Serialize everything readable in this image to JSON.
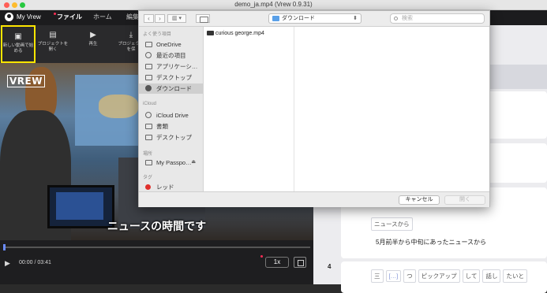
{
  "window": {
    "title": "demo_ja.mp4 (Vrew 0.9.31)"
  },
  "appbar": {
    "account_label": "My Vrew",
    "tabs": [
      {
        "label": "ファイル",
        "active": true
      },
      {
        "label": "ホーム",
        "active": false
      },
      {
        "label": "編集",
        "active": false
      }
    ]
  },
  "toolbar": {
    "items": [
      {
        "label": "新しい動画で始める",
        "icon": "video-file-icon",
        "highlighted": true
      },
      {
        "label": "プロジェクトを開く",
        "icon": "project-file-icon",
        "highlighted": false
      },
      {
        "label": "再生",
        "icon": "play-icon",
        "highlighted": false
      },
      {
        "label": "プロジェクトを保",
        "icon": "download-icon",
        "highlighted": false
      }
    ]
  },
  "video": {
    "logo": "VREW",
    "subtitle": "ニュースの時間です"
  },
  "player": {
    "time": "00:00 / 03:41",
    "speed": "1x",
    "progress": 0.0
  },
  "dialog": {
    "location": "ダウンロード",
    "search_placeholder": "検索",
    "sidebar": {
      "favorites_header": "よく使う項目",
      "favorites": [
        {
          "label": "OneDrive",
          "icon": "folder-icon"
        },
        {
          "label": "最近の項目",
          "icon": "clock-icon"
        },
        {
          "label": "アプリケーシ…",
          "icon": "applications-icon"
        },
        {
          "label": "デスクトップ",
          "icon": "desktop-icon"
        },
        {
          "label": "ダウンロード",
          "icon": "downloads-icon",
          "selected": true
        }
      ],
      "icloud_header": "iCloud",
      "icloud": [
        {
          "label": "iCloud Drive",
          "icon": "cloud-icon"
        },
        {
          "label": "書類",
          "icon": "document-icon"
        },
        {
          "label": "デスクトップ",
          "icon": "desktop-icon"
        }
      ],
      "locations_header": "場所",
      "locations": [
        {
          "label": "My Passpo…",
          "icon": "drive-icon",
          "eject": "⏏"
        }
      ],
      "tags_header": "タグ",
      "tags": [
        {
          "label": "レッド",
          "color": "#e0302c"
        }
      ]
    },
    "files": [
      {
        "name": "curious george.mp4",
        "icon": "video-file-icon"
      }
    ],
    "buttons": {
      "cancel": "キャンセル",
      "open": "開く"
    }
  },
  "editor": {
    "block3_words": [
      "ニュースから"
    ],
    "block3_sentence": "5月前半から中旬にあったニュースから",
    "row4_number": "4",
    "row4_words": [
      "三",
      "[…]",
      "つ",
      "ピックアップ",
      "して",
      "話し",
      "たいと"
    ]
  }
}
